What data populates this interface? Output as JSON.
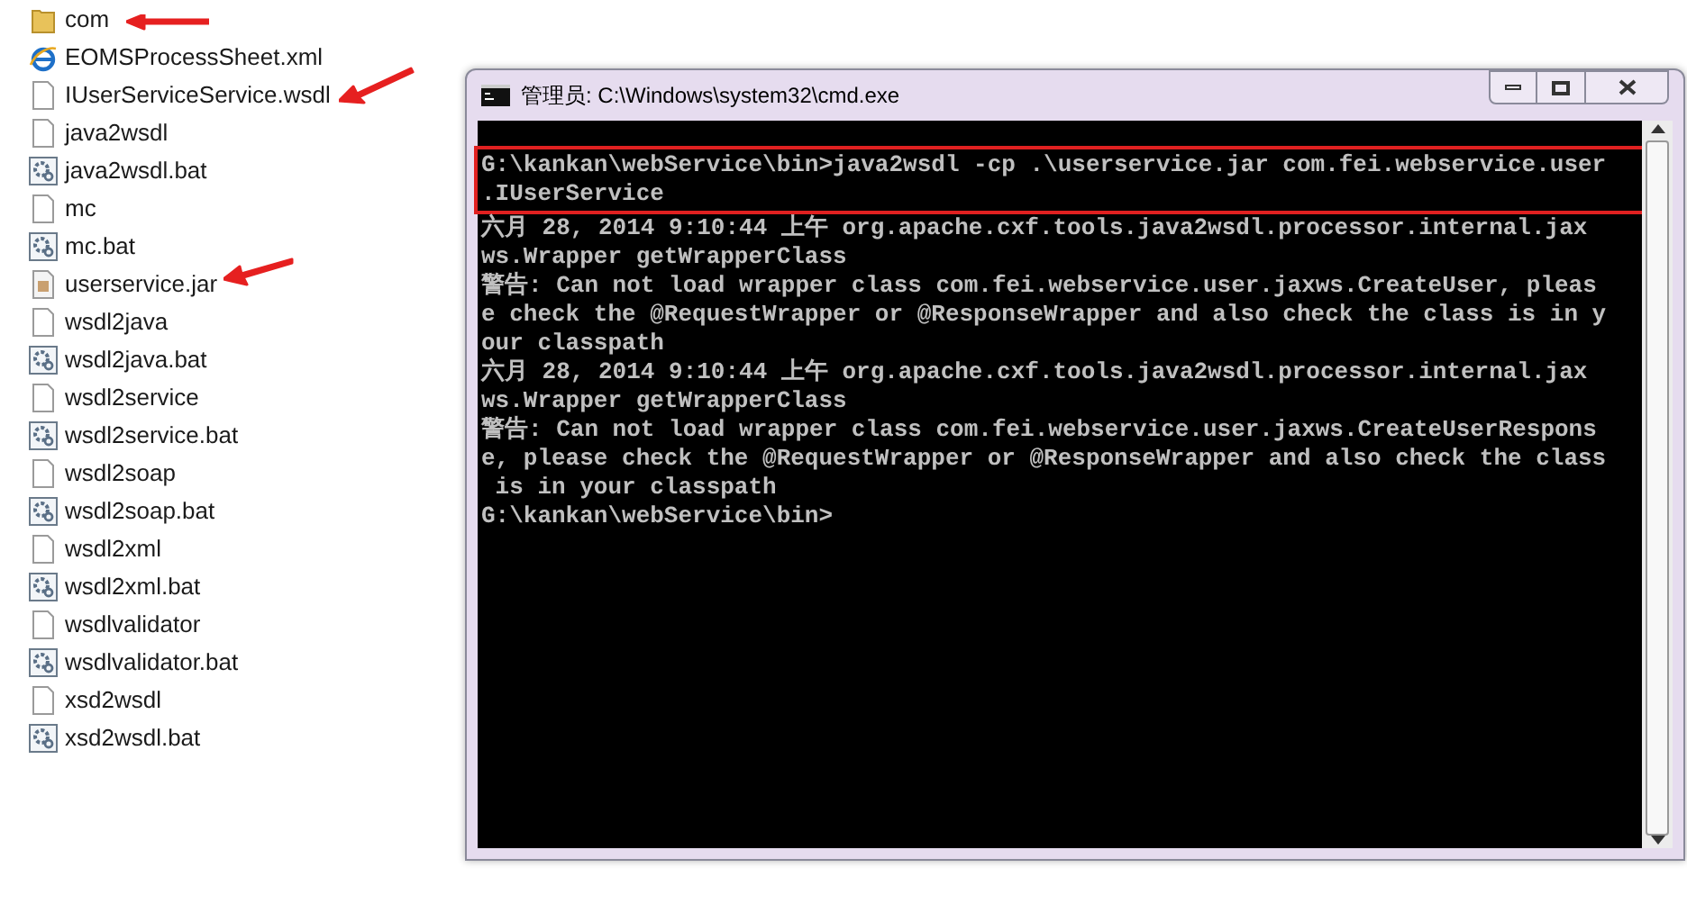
{
  "files": [
    {
      "name": "com",
      "kind": "folder"
    },
    {
      "name": "EOMSProcessSheet.xml",
      "kind": "xml"
    },
    {
      "name": "IUserServiceService.wsdl",
      "kind": "file"
    },
    {
      "name": "java2wsdl",
      "kind": "file"
    },
    {
      "name": "java2wsdl.bat",
      "kind": "bat"
    },
    {
      "name": "mc",
      "kind": "file"
    },
    {
      "name": "mc.bat",
      "kind": "bat"
    },
    {
      "name": "userservice.jar",
      "kind": "jar"
    },
    {
      "name": "wsdl2java",
      "kind": "file"
    },
    {
      "name": "wsdl2java.bat",
      "kind": "bat"
    },
    {
      "name": "wsdl2service",
      "kind": "file"
    },
    {
      "name": "wsdl2service.bat",
      "kind": "bat"
    },
    {
      "name": "wsdl2soap",
      "kind": "file"
    },
    {
      "name": "wsdl2soap.bat",
      "kind": "bat"
    },
    {
      "name": "wsdl2xml",
      "kind": "file"
    },
    {
      "name": "wsdl2xml.bat",
      "kind": "bat"
    },
    {
      "name": "wsdlvalidator",
      "kind": "file"
    },
    {
      "name": "wsdlvalidator.bat",
      "kind": "bat"
    },
    {
      "name": "xsd2wsdl",
      "kind": "file"
    },
    {
      "name": "xsd2wsdl.bat",
      "kind": "bat"
    }
  ],
  "window": {
    "title": "管理员: C:\\Windows\\system32\\cmd.exe"
  },
  "console": {
    "highlighted_lines": [
      "G:\\kankan\\webService\\bin>java2wsdl -cp .\\userservice.jar com.fei.webservice.user",
      ".IUserService"
    ],
    "lines": [
      "六月 28, 2014 9:10:44 上午 org.apache.cxf.tools.java2wsdl.processor.internal.jax",
      "ws.Wrapper getWrapperClass",
      "警告: Can not load wrapper class com.fei.webservice.user.jaxws.CreateUser, pleas",
      "e check the @RequestWrapper or @ResponseWrapper and also check the class is in y",
      "our classpath",
      "六月 28, 2014 9:10:44 上午 org.apache.cxf.tools.java2wsdl.processor.internal.jax",
      "ws.Wrapper getWrapperClass",
      "警告: Can not load wrapper class com.fei.webservice.user.jaxws.CreateUserRespons",
      "e, please check the @RequestWrapper or @ResponseWrapper and also check the class",
      " is in your classpath",
      "G:\\kankan\\webService\\bin>"
    ]
  }
}
